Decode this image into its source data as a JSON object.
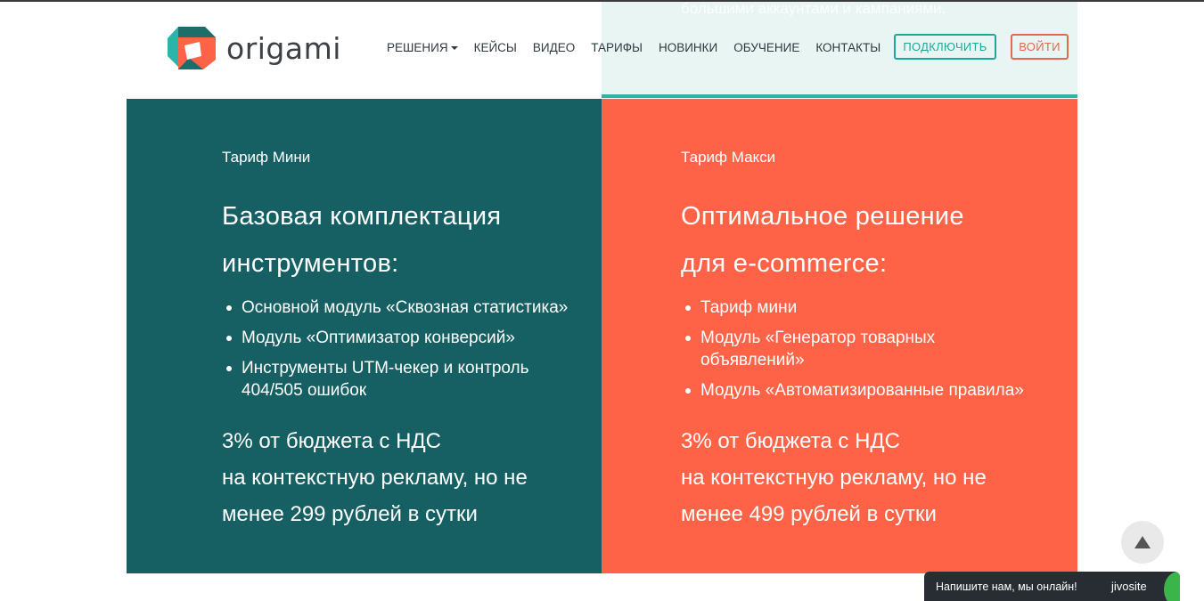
{
  "header": {
    "logo_text": "origami",
    "nav": [
      {
        "label": "РЕШЕНИЯ",
        "has_dropdown": true
      },
      {
        "label": "КЕЙСЫ"
      },
      {
        "label": "ВИДЕО"
      },
      {
        "label": "ТАРИФЫ"
      },
      {
        "label": "НОВИНКИ"
      },
      {
        "label": "ОБУЧЕНИЕ"
      },
      {
        "label": "КОНТАКТЫ"
      }
    ],
    "connect_label": "ПОДКЛЮЧИТЬ",
    "login_label": "ВОЙТИ"
  },
  "background_text": "большими аккаунтами и кампаниями.",
  "tariffs": {
    "mini": {
      "label": "Тариф Мини",
      "title_line1": "Базовая комплектация",
      "title_line2": "инструментов:",
      "features": [
        "Основной модуль «Сквозная статистика»",
        "Модуль «Оптимизатор конверсий»",
        "Инструменты UTM-чекер и контроль 404/505 ошибок"
      ],
      "price_line1": "3% от бюджета с НДС",
      "price_line2": "на контекстную рекламу, но не",
      "price_line3": "менее 299 рублей в сутки"
    },
    "maxi": {
      "label": "Тариф Макси",
      "title_line1": "Оптимальное решение",
      "title_line2": "для e-commerce:",
      "features": [
        "Тариф мини",
        "Модуль «Генератор товарных объявлений»",
        "Модуль «Автоматизированные правила»"
      ],
      "price_line1": "3% от бюджета с НДС",
      "price_line2": "на контекстную рекламу, но не",
      "price_line3": "менее 499 рублей в сутки"
    }
  },
  "chat_widget": {
    "text": "Напишите нам, мы онлайн!",
    "brand": "jivosite"
  },
  "colors": {
    "mini_bg": "#166064",
    "maxi_bg": "#ff6347",
    "accent_teal": "#1fa89a",
    "accent_orange": "#e0694e"
  },
  "icons": {
    "scroll_top": "arrow-up-icon",
    "logo": "origami-logo-icon"
  }
}
